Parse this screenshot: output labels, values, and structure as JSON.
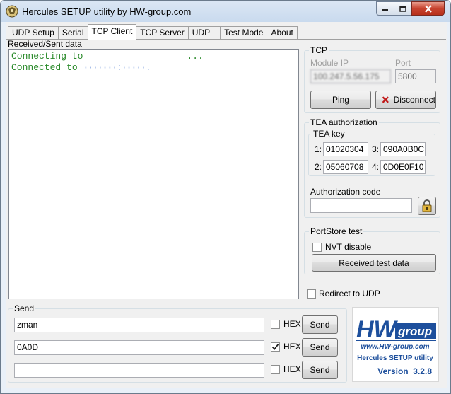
{
  "window": {
    "title": "Hercules SETUP utility by HW-group.com"
  },
  "tabs": [
    {
      "label": "UDP Setup",
      "active": false
    },
    {
      "label": "Serial",
      "active": false
    },
    {
      "label": "TCP Client",
      "active": true
    },
    {
      "label": "TCP Server",
      "active": false
    },
    {
      "label": "UDP",
      "active": false
    },
    {
      "label": "Test Mode",
      "active": false
    },
    {
      "label": "About",
      "active": false
    }
  ],
  "received": {
    "label": "Received/Sent data",
    "lines": [
      {
        "prefix": "Connecting to",
        "masked": "",
        "suffix": "..."
      },
      {
        "prefix": "Connected to",
        "masked": "·······:·····.",
        "suffix": ""
      }
    ]
  },
  "tcp": {
    "title": "TCP",
    "module_ip_label": "Module IP",
    "module_ip_value": "100.247.5.56.175",
    "port_label": "Port",
    "port_value": "5800",
    "ping_label": "Ping",
    "disconnect_label": "Disconnect"
  },
  "tea": {
    "title": "TEA authorization",
    "key_title": "TEA key",
    "keys": [
      {
        "num": "1:",
        "value": "01020304"
      },
      {
        "num": "3:",
        "value": "090A0B0C"
      },
      {
        "num": "2:",
        "value": "05060708"
      },
      {
        "num": "4:",
        "value": "0D0E0F10"
      }
    ],
    "auth_label": "Authorization code",
    "auth_value": ""
  },
  "portstore": {
    "title": "PortStore test",
    "nvt_label": "NVT disable",
    "nvt_checked": false,
    "received_test_label": "Received test data"
  },
  "redirect": {
    "label": "Redirect to UDP",
    "checked": false
  },
  "send": {
    "title": "Send",
    "hex_label": "HEX",
    "send_label": "Send",
    "rows": [
      {
        "value": "zman",
        "hex": false
      },
      {
        "value": "0A0D",
        "hex": true
      },
      {
        "value": "",
        "hex": false
      }
    ]
  },
  "logo": {
    "brand_hw": "HW",
    "brand_group": "group",
    "url": "www.HW-group.com",
    "product": "Hercules SETUP utility",
    "version": "Version  3.2.8"
  },
  "colors": {
    "received_text": "#2a8a2a",
    "logo_blue": "#1d4f9c",
    "disconnect_x": "#c01818"
  }
}
